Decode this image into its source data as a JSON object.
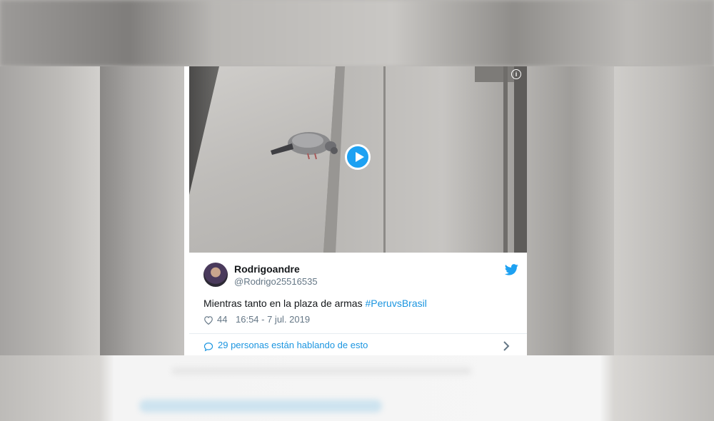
{
  "tweet": {
    "display_name": "Rodrigoandre",
    "handle": "@Rodrigo25516535",
    "text": "Mientras tanto en la plaza de armas ",
    "hashtag": "#PeruvsBrasil",
    "likes": "44",
    "timestamp": "16:54 - 7 jul. 2019",
    "conversation": "29 personas están hablando de esto"
  },
  "media": {
    "info_glyph": "i",
    "play_icon": "play-icon",
    "type": "video"
  },
  "icons": {
    "brand": "twitter-bird-icon",
    "like": "heart-icon",
    "conversation": "speech-bubble-icon",
    "more": "chevron-right-icon"
  },
  "colors": {
    "accent": "#1da1f2",
    "link": "#1b95e0",
    "muted": "#657786",
    "text": "#14171a"
  }
}
